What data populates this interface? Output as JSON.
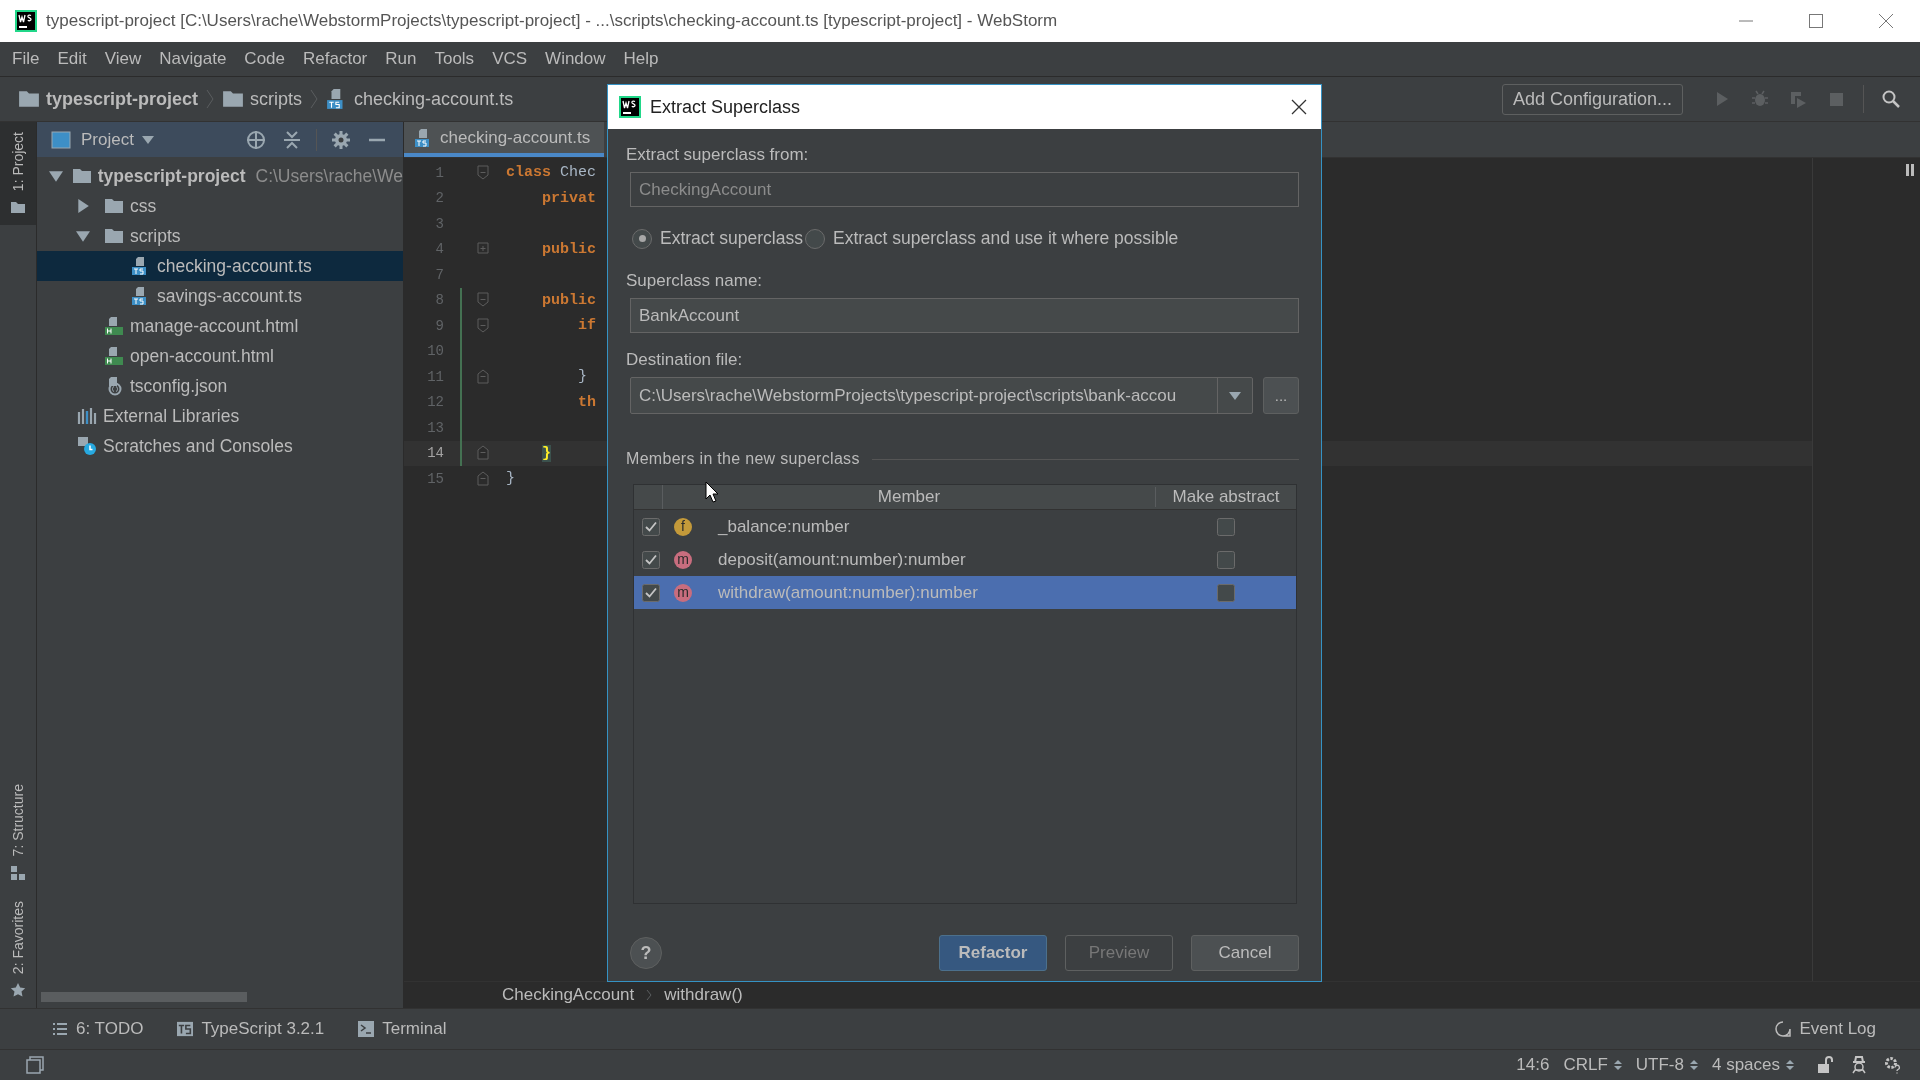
{
  "window": {
    "title": "typescript-project [C:\\Users\\rache\\WebstormProjects\\typescript-project] - ...\\scripts\\checking-account.ts [typescript-project] - WebStorm"
  },
  "menu": [
    "File",
    "Edit",
    "View",
    "Navigate",
    "Code",
    "Refactor",
    "Run",
    "Tools",
    "VCS",
    "Window",
    "Help"
  ],
  "breadcrumbs": [
    {
      "label": "typescript-project",
      "kind": "project"
    },
    {
      "label": "scripts",
      "kind": "folder"
    },
    {
      "label": "checking-account.ts",
      "kind": "ts"
    }
  ],
  "toolbar": {
    "config_button": "Add Configuration..."
  },
  "tool_stripe": {
    "top": [
      "1: Project"
    ],
    "bottom": [
      "7: Structure",
      "2: Favorites"
    ]
  },
  "project_panel": {
    "title": "Project",
    "tree": [
      {
        "label": "typescript-project",
        "hint": "C:\\Users\\rache\\We",
        "kind": "project",
        "expanded": true,
        "selected": false,
        "children": [
          {
            "label": "css",
            "kind": "folder",
            "expanded": false,
            "selected": false
          },
          {
            "label": "scripts",
            "kind": "folder",
            "expanded": true,
            "selected": false,
            "children": [
              {
                "label": "checking-account.ts",
                "kind": "ts",
                "selected": true
              },
              {
                "label": "savings-account.ts",
                "kind": "ts",
                "selected": false
              }
            ]
          },
          {
            "label": "manage-account.html",
            "kind": "html",
            "selected": false
          },
          {
            "label": "open-account.html",
            "kind": "html",
            "selected": false
          },
          {
            "label": "tsconfig.json",
            "kind": "json",
            "selected": false
          }
        ]
      },
      {
        "label": "External Libraries",
        "kind": "libraries",
        "selected": false
      },
      {
        "label": "Scratches and Consoles",
        "kind": "scratches",
        "selected": false
      }
    ]
  },
  "editor": {
    "tab": "checking-account.ts",
    "lines": [
      {
        "number": "1",
        "kind": "fold-start",
        "changed": false,
        "selected": false,
        "tokens": [
          {
            "text": "class",
            "kind": "keyword"
          },
          {
            "text": " Chec",
            "kind": "plain"
          }
        ]
      },
      {
        "number": "2",
        "kind": "plain",
        "changed": false,
        "selected": false,
        "tokens": [
          {
            "text": "    privat",
            "kind": "keyword"
          }
        ]
      },
      {
        "number": "3",
        "kind": "plain",
        "changed": false,
        "selected": false
      },
      {
        "number": "4",
        "kind": "fold-collapsed",
        "changed": false,
        "selected": false,
        "tokens": [
          {
            "text": "    public",
            "kind": "keyword"
          }
        ]
      },
      {
        "number": "7",
        "kind": "plain",
        "changed": false,
        "selected": false
      },
      {
        "number": "8",
        "kind": "fold-start",
        "changed": true,
        "selected": false,
        "tokens": [
          {
            "text": "    public",
            "kind": "keyword"
          }
        ]
      },
      {
        "number": "9",
        "kind": "fold-start",
        "changed": true,
        "selected": false,
        "tokens": [
          {
            "text": "        if",
            "kind": "keyword"
          }
        ]
      },
      {
        "number": "10",
        "kind": "plain",
        "changed": true,
        "selected": false
      },
      {
        "number": "11",
        "kind": "fold-end",
        "changed": true,
        "selected": false,
        "tokens": [
          {
            "text": "        }",
            "kind": "plain"
          }
        ]
      },
      {
        "number": "12",
        "kind": "plain",
        "changed": true,
        "selected": false,
        "tokens": [
          {
            "text": "        th",
            "kind": "keyword"
          }
        ]
      },
      {
        "number": "13",
        "kind": "plain",
        "changed": true,
        "selected": false
      },
      {
        "number": "14",
        "kind": "fold-end",
        "changed": true,
        "selected": true,
        "tokens": [
          {
            "text": "    }",
            "kind": "brace-match"
          }
        ]
      },
      {
        "number": "15",
        "kind": "fold-end",
        "changed": false,
        "selected": false,
        "tokens": [
          {
            "text": "}",
            "kind": "plain"
          }
        ]
      }
    ],
    "footer_crumbs": [
      "CheckingAccount",
      "withdraw()"
    ]
  },
  "dialog": {
    "title": "Extract Superclass",
    "from_label": "Extract superclass from:",
    "from_value": "CheckingAccount",
    "options": [
      {
        "label": "Extract superclass",
        "selected": true
      },
      {
        "label": "Extract superclass and use it where possible",
        "selected": false
      }
    ],
    "name_label": "Superclass name:",
    "name_value": "BankAccount",
    "dest_label": "Destination file:",
    "dest_value": "C:\\Users\\rache\\WebstormProjects\\typescript-project\\scripts\\bank-accou",
    "browse": "...",
    "members_title": "Members in the new superclass",
    "columns": [
      "Member",
      "Make abstract"
    ],
    "members": [
      {
        "kind": "field",
        "badge": "f",
        "name": "_balance:number",
        "checked": true,
        "make_abstract": false,
        "selected": false
      },
      {
        "kind": "method",
        "badge": "m",
        "name": "deposit(amount:number):number",
        "checked": true,
        "make_abstract": false,
        "selected": false
      },
      {
        "kind": "method",
        "badge": "m",
        "name": "withdraw(amount:number):number",
        "checked": true,
        "make_abstract": false,
        "selected": true
      }
    ],
    "help": "?",
    "buttons": [
      {
        "label": "Refactor",
        "default": true,
        "disabled": false
      },
      {
        "label": "Preview",
        "default": false,
        "disabled": true
      },
      {
        "label": "Cancel",
        "default": false,
        "disabled": false
      }
    ]
  },
  "tool_windows": [
    {
      "label": "6: TODO",
      "kind": "todo"
    },
    {
      "label": "TypeScript 3.2.1",
      "kind": "typescript"
    },
    {
      "label": "Terminal",
      "kind": "terminal"
    }
  ],
  "event_log": "Event Log",
  "status_bar": {
    "position": "14:6",
    "line_separator": "CRLF",
    "encoding": "UTF-8",
    "indent": "4 spaces"
  }
}
